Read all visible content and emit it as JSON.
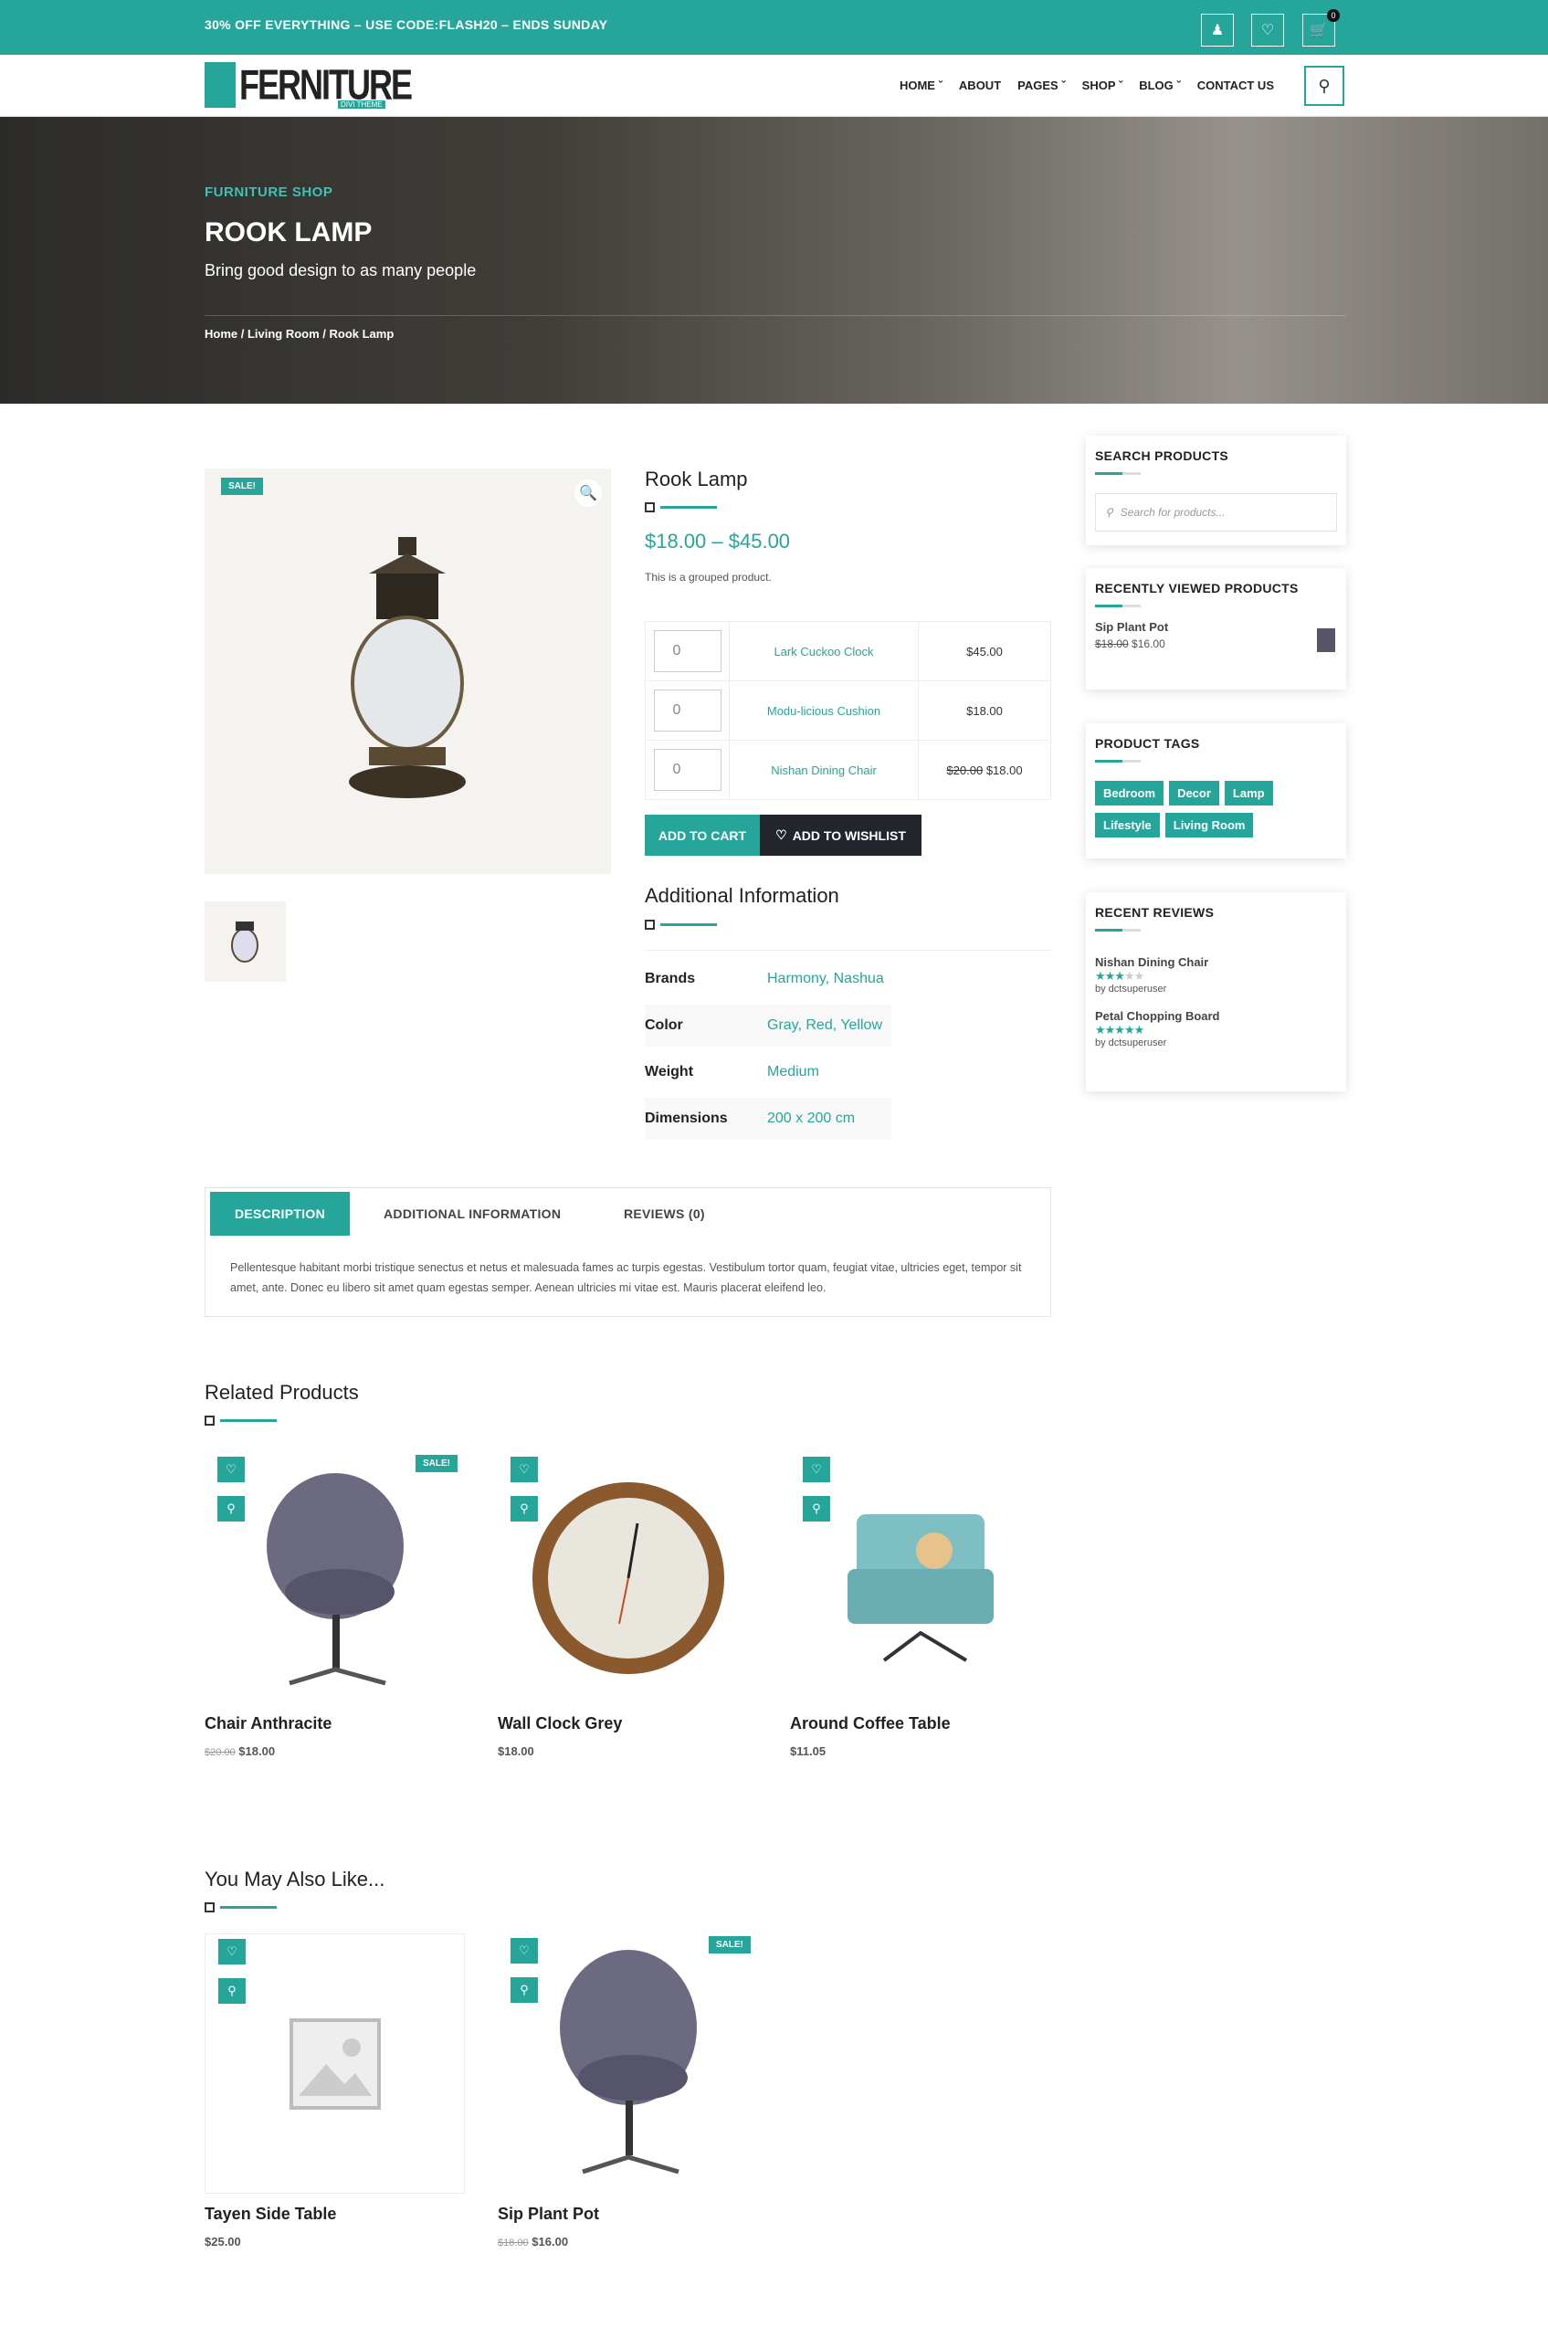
{
  "topbar": {
    "promo": "30% OFF EVERYTHING – USE CODE:FLASH20 – ENDS SUNDAY",
    "cart_count": "0"
  },
  "header": {
    "logo": "FERNITURE",
    "logo_sub": "DIVI THEME",
    "nav": [
      "HOME",
      "ABOUT",
      "PAGES",
      "SHOP",
      "BLOG",
      "CONTACT US"
    ]
  },
  "hero": {
    "kicker": "FURNITURE SHOP",
    "title": "ROOK LAMP",
    "subtitle": "Bring good design to as many people",
    "breadcrumb": "Home / Living Room / Rook Lamp"
  },
  "product": {
    "sale_badge": "SALE!",
    "title": "Rook Lamp",
    "price": "$18.00 – $45.00",
    "short_desc": "This is a grouped product.",
    "grouped": [
      {
        "qty": "0",
        "name": "Lark Cuckoo Clock",
        "price": "$45.00",
        "old": ""
      },
      {
        "qty": "0",
        "name": "Modu-licious Cushion",
        "price": "$18.00",
        "old": ""
      },
      {
        "qty": "0",
        "name": "Nishan Dining Chair",
        "price": "$18.00",
        "old": "$20.00"
      }
    ],
    "add_to_cart": "ADD TO CART",
    "add_to_wishlist": "ADD TO WISHLIST"
  },
  "additional": {
    "title": "Additional Information",
    "rows": [
      {
        "k": "Brands",
        "v": "Harmony, Nashua"
      },
      {
        "k": "Color",
        "v": "Gray, Red, Yellow"
      },
      {
        "k": "Weight",
        "v": "Medium"
      },
      {
        "k": "Dimensions",
        "v": "200 x 200 cm"
      }
    ]
  },
  "tabs": {
    "items": [
      "DESCRIPTION",
      "ADDITIONAL INFORMATION",
      "REVIEWS (0)"
    ],
    "description": "Pellentesque habitant morbi tristique senectus et netus et malesuada fames ac turpis egestas. Vestibulum tortor quam, feugiat vitae, ultricies eget, tempor sit amet, ante. Donec eu libero sit amet quam egestas semper. Aenean ultricies mi vitae est. Mauris placerat eleifend leo."
  },
  "related": {
    "title": "Related Products",
    "items": [
      {
        "name": "Chair Anthracite",
        "old": "$20.00",
        "price": "$18.00",
        "sale": "SALE!"
      },
      {
        "name": "Wall Clock Grey",
        "old": "",
        "price": "$18.00",
        "sale": ""
      },
      {
        "name": "Around Coffee Table",
        "old": "",
        "price": "$11.05",
        "sale": ""
      }
    ]
  },
  "also": {
    "title": "You May Also Like...",
    "items": [
      {
        "name": "Tayen Side Table",
        "old": "",
        "price": "$25.00",
        "sale": ""
      },
      {
        "name": "Sip Plant Pot",
        "old": "$18.00",
        "price": "$16.00",
        "sale": "SALE!"
      }
    ]
  },
  "sidebar": {
    "search_title": "SEARCH PRODUCTS",
    "search_placeholder": "Search for products...",
    "recent_title": "RECENTLY VIEWED PRODUCTS",
    "recent": {
      "name": "Sip Plant Pot",
      "old": "$18.00",
      "price": "$16.00"
    },
    "tags_title": "PRODUCT TAGS",
    "tags": [
      "Bedroom",
      "Decor",
      "Lamp",
      "Lifestyle",
      "Living Room"
    ],
    "reviews_title": "RECENT REVIEWS",
    "reviews": [
      {
        "name": "Nishan Dining Chair",
        "rating": 3,
        "by": "by dctsuperuser"
      },
      {
        "name": "Petal Chopping Board",
        "rating": 5,
        "by": "by dctsuperuser"
      }
    ]
  },
  "colors": {
    "accent": "#26a69a",
    "dark": "#22252b"
  }
}
